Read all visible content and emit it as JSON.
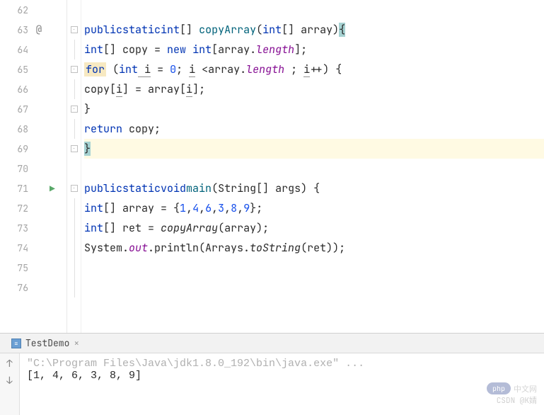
{
  "gutter": {
    "lines": [
      "62",
      "63",
      "64",
      "65",
      "66",
      "67",
      "68",
      "69",
      "70",
      "71",
      "72",
      "73",
      "74",
      "75",
      "76"
    ],
    "override_anno": "@",
    "run_icon": "▶"
  },
  "code": {
    "l62": "",
    "l63": {
      "kw1": "public",
      "kw2": "static",
      "type": "int",
      "br": "[] ",
      "name": "copyArray",
      "paren_open": "(",
      "ptype": "int",
      "pbr": "[] ",
      "pname": "array",
      "paren_close": ")",
      "brace": "{"
    },
    "l64": {
      "type": "int",
      "br": "[] ",
      "var": "copy = ",
      "kw": "new",
      "type2": " int",
      "rest": "[array.",
      "field": "length",
      "end": "];"
    },
    "l65": {
      "for": "for",
      "sp": " (",
      "type": "int",
      "i": " i",
      "eq": " = ",
      "zero": "0",
      "semi1": "; ",
      "i2": "i",
      "cmp": " <array.",
      "field": "length",
      "semi2": " ; ",
      "i3": "i",
      "inc": "++) {"
    },
    "l66": {
      "txt1": "copy[",
      "i1": "i",
      "txt2": "] = array[",
      "i2": "i",
      "txt3": "];"
    },
    "l67": "}",
    "l68": {
      "kw": "return",
      "rest": " copy;"
    },
    "l69": "}",
    "l70": "",
    "l71": {
      "kw1": "public",
      "kw2": "static",
      "kw3": "void",
      "name": "main",
      "paren": "(String[] args) {"
    },
    "l72": {
      "type": "int",
      "br": "[] ",
      "var": "array = {",
      "n1": "1",
      "c1": ",",
      "n2": "4",
      "c2": ",",
      "n3": "6",
      "c3": ",",
      "n4": "3",
      "c4": ",",
      "n5": "8",
      "c5": ",",
      "n6": "9",
      "end": "};"
    },
    "l73": {
      "type": "int",
      "br": "[] ",
      "var": "ret = ",
      "call": "copyArray",
      "rest": "(array);"
    },
    "l74": {
      "sys": "System.",
      "out": "out",
      "dot": ".println(Arrays.",
      "ts": "toString",
      "end": "(ret));"
    },
    "l75": "",
    "l76": ""
  },
  "console": {
    "tab_name": "TestDemo",
    "close": "×",
    "cmd": "\"C:\\Program Files\\Java\\jdk1.8.0_192\\bin\\java.exe\" ...",
    "output": "[1, 4, 6, 3, 8, 9]",
    "up": "↑",
    "down": "↓"
  },
  "watermark": {
    "php": "php",
    "cn": "中文网",
    "csdn": "CSDN @K婧"
  }
}
